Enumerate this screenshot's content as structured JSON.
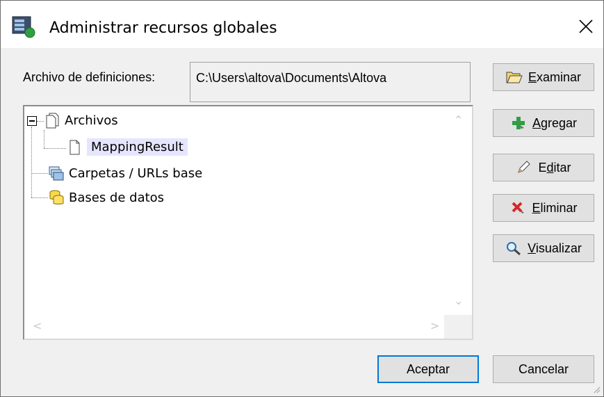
{
  "window": {
    "title": "Administrar recursos globales"
  },
  "definitions": {
    "label": "Archivo de definiciones:",
    "path": "C:\\Users\\altova\\Documents\\Altova"
  },
  "tree": {
    "items": [
      {
        "label": "Archivos",
        "icon": "files-icon",
        "expanded": true
      },
      {
        "label": "MappingResult",
        "icon": "file-icon",
        "selected": true
      },
      {
        "label": "Carpetas / URLs base",
        "icon": "folders-icon"
      },
      {
        "label": "Bases de datos",
        "icon": "database-icon"
      }
    ]
  },
  "buttons": {
    "examinar": {
      "pre": "",
      "accel": "E",
      "post": "xaminar"
    },
    "agregar": {
      "pre": "",
      "accel": "A",
      "post": "gregar"
    },
    "editar": {
      "pre": "E",
      "accel": "d",
      "post": "itar"
    },
    "eliminar": {
      "pre": "",
      "accel": "E",
      "post": "liminar"
    },
    "visualizar": {
      "pre": "",
      "accel": "V",
      "post": "isualizar"
    },
    "aceptar": "Aceptar",
    "cancelar": "Cancelar"
  },
  "colors": {
    "selection": "#e5e5ff",
    "default_button_border": "#0078d7"
  }
}
